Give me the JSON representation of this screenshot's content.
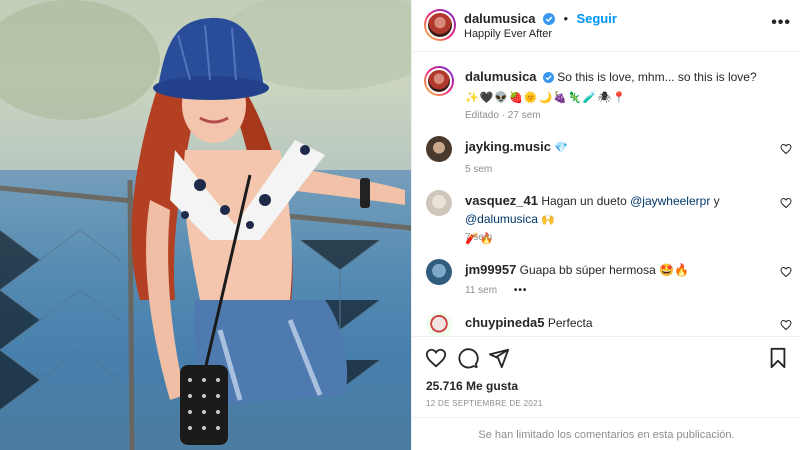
{
  "header": {
    "username": "dalumusica",
    "separator": "•",
    "follow_label": "Seguir",
    "subtitle": "Happily Ever After",
    "more_label": "•••"
  },
  "caption": {
    "username": "dalumusica",
    "text": "So this is love, mhm... so this is love?",
    "emojis": "✨🖤👽🍓🌞🌙🍇🦎🧪🕷📍",
    "meta": "Editado · 27 sem"
  },
  "comments": [
    {
      "username": "jayking.music",
      "text": "💎",
      "meta": "5 sem"
    },
    {
      "username": "vasquez_41",
      "text_before": "Hagan un dueto ",
      "mention1": "@jaywheelerpr",
      "text_mid": " y ",
      "mention2": "@dalumusica",
      "emoji_inline": "🙌",
      "emoji_line2": "🧨🔥",
      "meta": "7 sem"
    },
    {
      "username": "jm99957",
      "text": "Guapa bb súper hermosa 🤩🔥",
      "meta": "11 sem",
      "more": "•••"
    },
    {
      "username": "chuypineda5",
      "text": "Perfecta"
    }
  ],
  "actions": {
    "likes": "25.716 Me gusta",
    "date": "12 DE SEPTIEMBRE DE 2021",
    "comments_limited": "Se han limitado los comentarios en esta publicación."
  },
  "icons": [
    "verified-badge-icon",
    "heart-icon",
    "comment-icon",
    "share-icon",
    "bookmark-icon",
    "more-icon"
  ],
  "colors": {
    "accent": "#0095f6",
    "verified": "#3897f0",
    "text": "#262626",
    "muted": "#8e8e8e",
    "border": "#efefef"
  }
}
